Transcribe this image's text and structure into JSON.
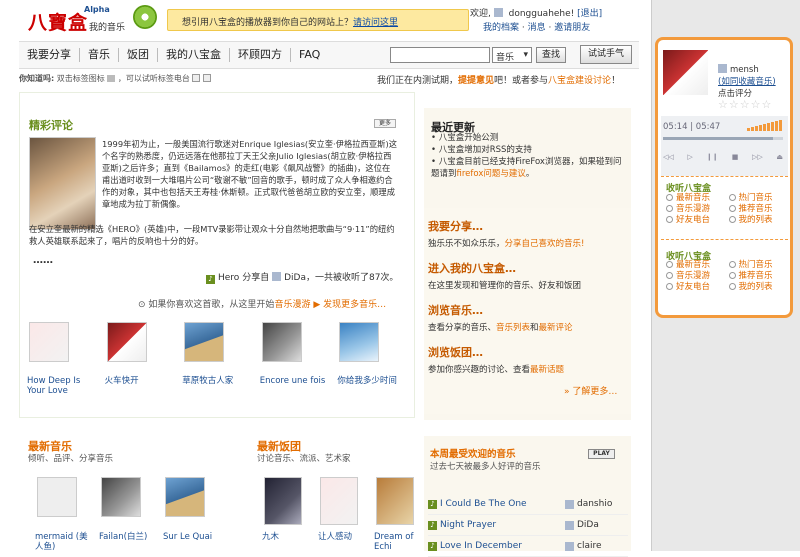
{
  "header": {
    "logo": "八寶盒",
    "alpha": "Alpha",
    "my_music": "我的音乐",
    "banner_text": "想引用八宝盒的播放器到你自己的网站上？",
    "banner_link": "请访问这里",
    "welcome": "欢迎,",
    "username": "dongguahehe!",
    "logout": "[退出]",
    "my_profile": "我的档案",
    "messages": "消息",
    "invite": "邀请朋友"
  },
  "nav": {
    "items": [
      "我要分享",
      "音乐",
      "饭团",
      "我的八宝盒",
      "环顾四方",
      "FAQ"
    ],
    "search_placeholder": "",
    "search_scope": "音乐",
    "search_button": "查找",
    "try_button": "试试手气"
  },
  "tips": {
    "label": "你知道吗:",
    "text": "双击标签图标",
    "text2": "，可以试听标签电台",
    "right_text": "我们正在内测试期，",
    "feedback": "提提意见",
    "right_text2": "吧！或者参与",
    "discuss": "八宝盒建设讨论",
    "end": "！"
  },
  "featured": {
    "title": "精彩评论",
    "more": "更多",
    "body": "1999年初为止，一般美国流行歌迷对Enrique Iglesias(安立奎·伊格拉西亚斯)这个名字的熟悉度，仍远远落在他那拉丁天王父亲Julio Iglesias(胡立欧·伊格拉西亚斯)之后许多；直到《Bailamos》的走红(电影《飙风战警》的插曲)，这位在甫出道时收到一大堆唱片公司“敬谢不敏”回音的歌手，顿时成了众人争相邀约合作的对象，其中也包括天王寿桂·休斯顿。正式取代爸爸胡立欧的安立奎，顺理成章地成为拉丁新偶像。",
    "body2": "在安立奎最新的精选《HERO》(英雄)中，一段MTV录影带让观众十分自然地把歌曲与“9·11”的纽约救人英雄联系起来了，唱片的反响也十分的好。",
    "ellipsis": "……",
    "song": "Hero",
    "shared_by": "分享自",
    "user": "DiDa",
    "count": "，一共被收听了87次。",
    "hint": "如果你喜欢这首歌，从这里开始",
    "hint_link": "音乐漫游",
    "discover": "发现更多音乐…"
  },
  "albums": [
    {
      "label": "How Deep Is Your Love",
      "cover": "coverD"
    },
    {
      "label": "火车快开",
      "cover": "cover"
    },
    {
      "label": "草原牧古人家",
      "cover": "coverC"
    },
    {
      "label": "Encore une fois",
      "cover": "coverB"
    },
    {
      "label": "你给我多少时间",
      "cover": "coverG"
    }
  ],
  "updates": {
    "title": "最近更新",
    "items": [
      "八宝盒开始公测",
      "八宝盒增加对RSS的支持",
      "八宝盒目前已经支持FireFox浏览器，如果碰到问题请到"
    ],
    "firefox_link": "firefox问题与建议",
    "period": "。"
  },
  "actions": [
    {
      "title": "我要分享…",
      "desc": "独乐乐不如众乐乐，",
      "link": "分享自己喜欢的音乐!"
    },
    {
      "title": "进入我的八宝盒…",
      "desc": "在这里发现和管理你的音乐、好友和饭团"
    },
    {
      "title": "浏览音乐…",
      "desc": "查看分享的音乐、",
      "link": "音乐列表",
      "desc2": "和",
      "link2": "最新评论"
    },
    {
      "title": "浏览饭团…",
      "desc": "参加你感兴趣的讨论、查看",
      "link": "最新话题"
    }
  ],
  "learn_more": "» 了解更多…",
  "latest_music": {
    "title": "最新音乐",
    "sub": "倾听、品评、分享音乐",
    "albums": [
      {
        "label": "mermaid (美人鱼)",
        "cover": ""
      },
      {
        "label": "Failan(白兰)",
        "cover": "coverB"
      },
      {
        "label": "Sur Le Quai",
        "cover": "coverC"
      }
    ]
  },
  "latest_groups": {
    "title": "最新饭团",
    "sub": "讨论音乐、流派、艺术家",
    "albums": [
      {
        "label": "九木",
        "cover": "coverF"
      },
      {
        "label": "让人感动",
        "cover": "coverD"
      },
      {
        "label": "Dream of Echi",
        "cover": "coverE"
      }
    ]
  },
  "popular": {
    "title": "本周最受欢迎的音乐",
    "sub": "过去七天被最多人好评的音乐",
    "play": "PLAY",
    "rows": [
      {
        "song": "I Could Be The One",
        "user": "danshio"
      },
      {
        "song": "Night Prayer",
        "user": "DiDa"
      },
      {
        "song": "Love In December",
        "user": "claire"
      }
    ]
  },
  "player": {
    "user": "mensh",
    "collect": "(如同收藏音乐)",
    "rate": "点击评分",
    "time_current": "05:14",
    "time_total": "05:47",
    "listen_title": "收听八宝盒",
    "options": [
      "最新音乐",
      "热门音乐",
      "音乐漫游",
      "推荐音乐",
      "好友电台",
      "我的列表"
    ],
    "listen_title2": "收听八宝盒",
    "options2": [
      "最新音乐",
      "热门音乐",
      "音乐漫游",
      "推荐音乐",
      "好友电台",
      "我的列表"
    ]
  },
  "colors": {
    "accent": "#6a8f1f",
    "orange": "#e26c00",
    "player_border": "#f39a3c"
  }
}
